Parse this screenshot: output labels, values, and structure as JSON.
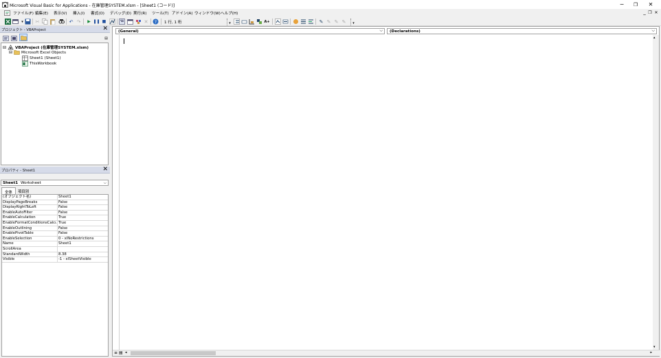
{
  "window": {
    "title": "Microsoft Visual Basic for Applications - 在庫管理SYSTEM.xlsm - [Sheet1 (コード)]",
    "controls": {
      "minimize": "─",
      "restore": "❐",
      "close": "✕"
    },
    "doc_controls": {
      "minimize": "_",
      "restore": "❐",
      "close": "✕"
    }
  },
  "menu": {
    "items": [
      "ファイル(F)",
      "編集(E)",
      "表示(V)",
      "挿入(I)",
      "書式(O)",
      "デバッグ(D)",
      "実行(R)",
      "ツール(T)",
      "アドイン(A)",
      "ウィンドウ(W)",
      "ヘルプ(H)"
    ]
  },
  "toolbar": {
    "position": "1 行, 1 桁"
  },
  "project": {
    "header": "プロジェクト - VBAProject",
    "close": "✕",
    "tree": {
      "root": "VBAProject (在庫管理SYSTEM.xlsm)",
      "folder": "Microsoft Excel Objects",
      "items": [
        "Sheet1 (Sheet1)",
        "ThisWorkbook"
      ]
    },
    "expander_root": "⊟",
    "expander_folder": "⊟"
  },
  "properties": {
    "header": "プロパティ - Sheet1",
    "close": "✕",
    "object_name": "Sheet1",
    "object_type": "Worksheet",
    "tabs": [
      "全体",
      "項目別"
    ],
    "rows": [
      {
        "name": "(オブジェクト名)",
        "value": "Sheet1"
      },
      {
        "name": "DisplayPageBreaks",
        "value": "False"
      },
      {
        "name": "DisplayRightToLeft",
        "value": "False"
      },
      {
        "name": "EnableAutoFilter",
        "value": "False"
      },
      {
        "name": "EnableCalculation",
        "value": "True"
      },
      {
        "name": "EnableFormatConditionsCalcu",
        "value": "True"
      },
      {
        "name": "EnableOutlining",
        "value": "False"
      },
      {
        "name": "EnablePivotTable",
        "value": "False"
      },
      {
        "name": "EnableSelection",
        "value": "0 - xlNoRestrictions"
      },
      {
        "name": "Name",
        "value": "Sheet1"
      },
      {
        "name": "ScrollArea",
        "value": ""
      },
      {
        "name": "StandardWidth",
        "value": "8.38"
      },
      {
        "name": "Visible",
        "value": "-1 - xlSheetVisible"
      }
    ]
  },
  "code": {
    "object_combo": "(General)",
    "proc_combo": "(Declarations)"
  }
}
